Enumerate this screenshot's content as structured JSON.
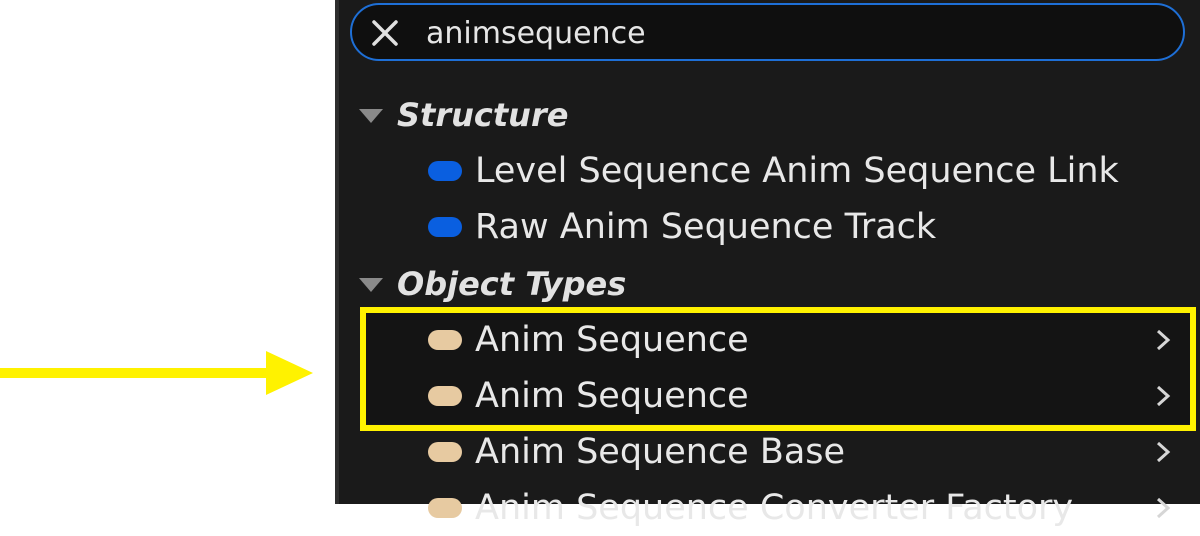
{
  "colors": {
    "panel_bg": "#1a1a1a",
    "search_border": "#1e6fd6",
    "struct_icon": "#0a5fe0",
    "object_icon": "#e7caa1",
    "highlight": "#fff200",
    "text": "#e8e8e8"
  },
  "search": {
    "value": "animsequence",
    "clear_icon": "close-icon"
  },
  "sections": [
    {
      "title": "Structure",
      "icon": "collapse-triangle-icon",
      "items": [
        {
          "label": "Level Sequence Anim Sequence Link",
          "icon": "struct-pill-icon"
        },
        {
          "label": "Raw Anim Sequence Track",
          "icon": "struct-pill-icon"
        }
      ]
    },
    {
      "title": "Object Types",
      "icon": "collapse-triangle-icon",
      "items": [
        {
          "label": "Anim Sequence",
          "icon": "object-pill-icon",
          "has_submenu": true,
          "highlighted": true
        },
        {
          "label": "Anim Sequence",
          "icon": "object-pill-icon",
          "has_submenu": true,
          "highlighted": true
        },
        {
          "label": "Anim Sequence Base",
          "icon": "object-pill-icon",
          "has_submenu": true
        },
        {
          "label": "Anim Sequence Converter Factory",
          "icon": "object-pill-icon",
          "has_submenu": true
        }
      ]
    }
  ],
  "annotation": {
    "arrow_color": "#fff200",
    "box_color": "#fff200"
  }
}
